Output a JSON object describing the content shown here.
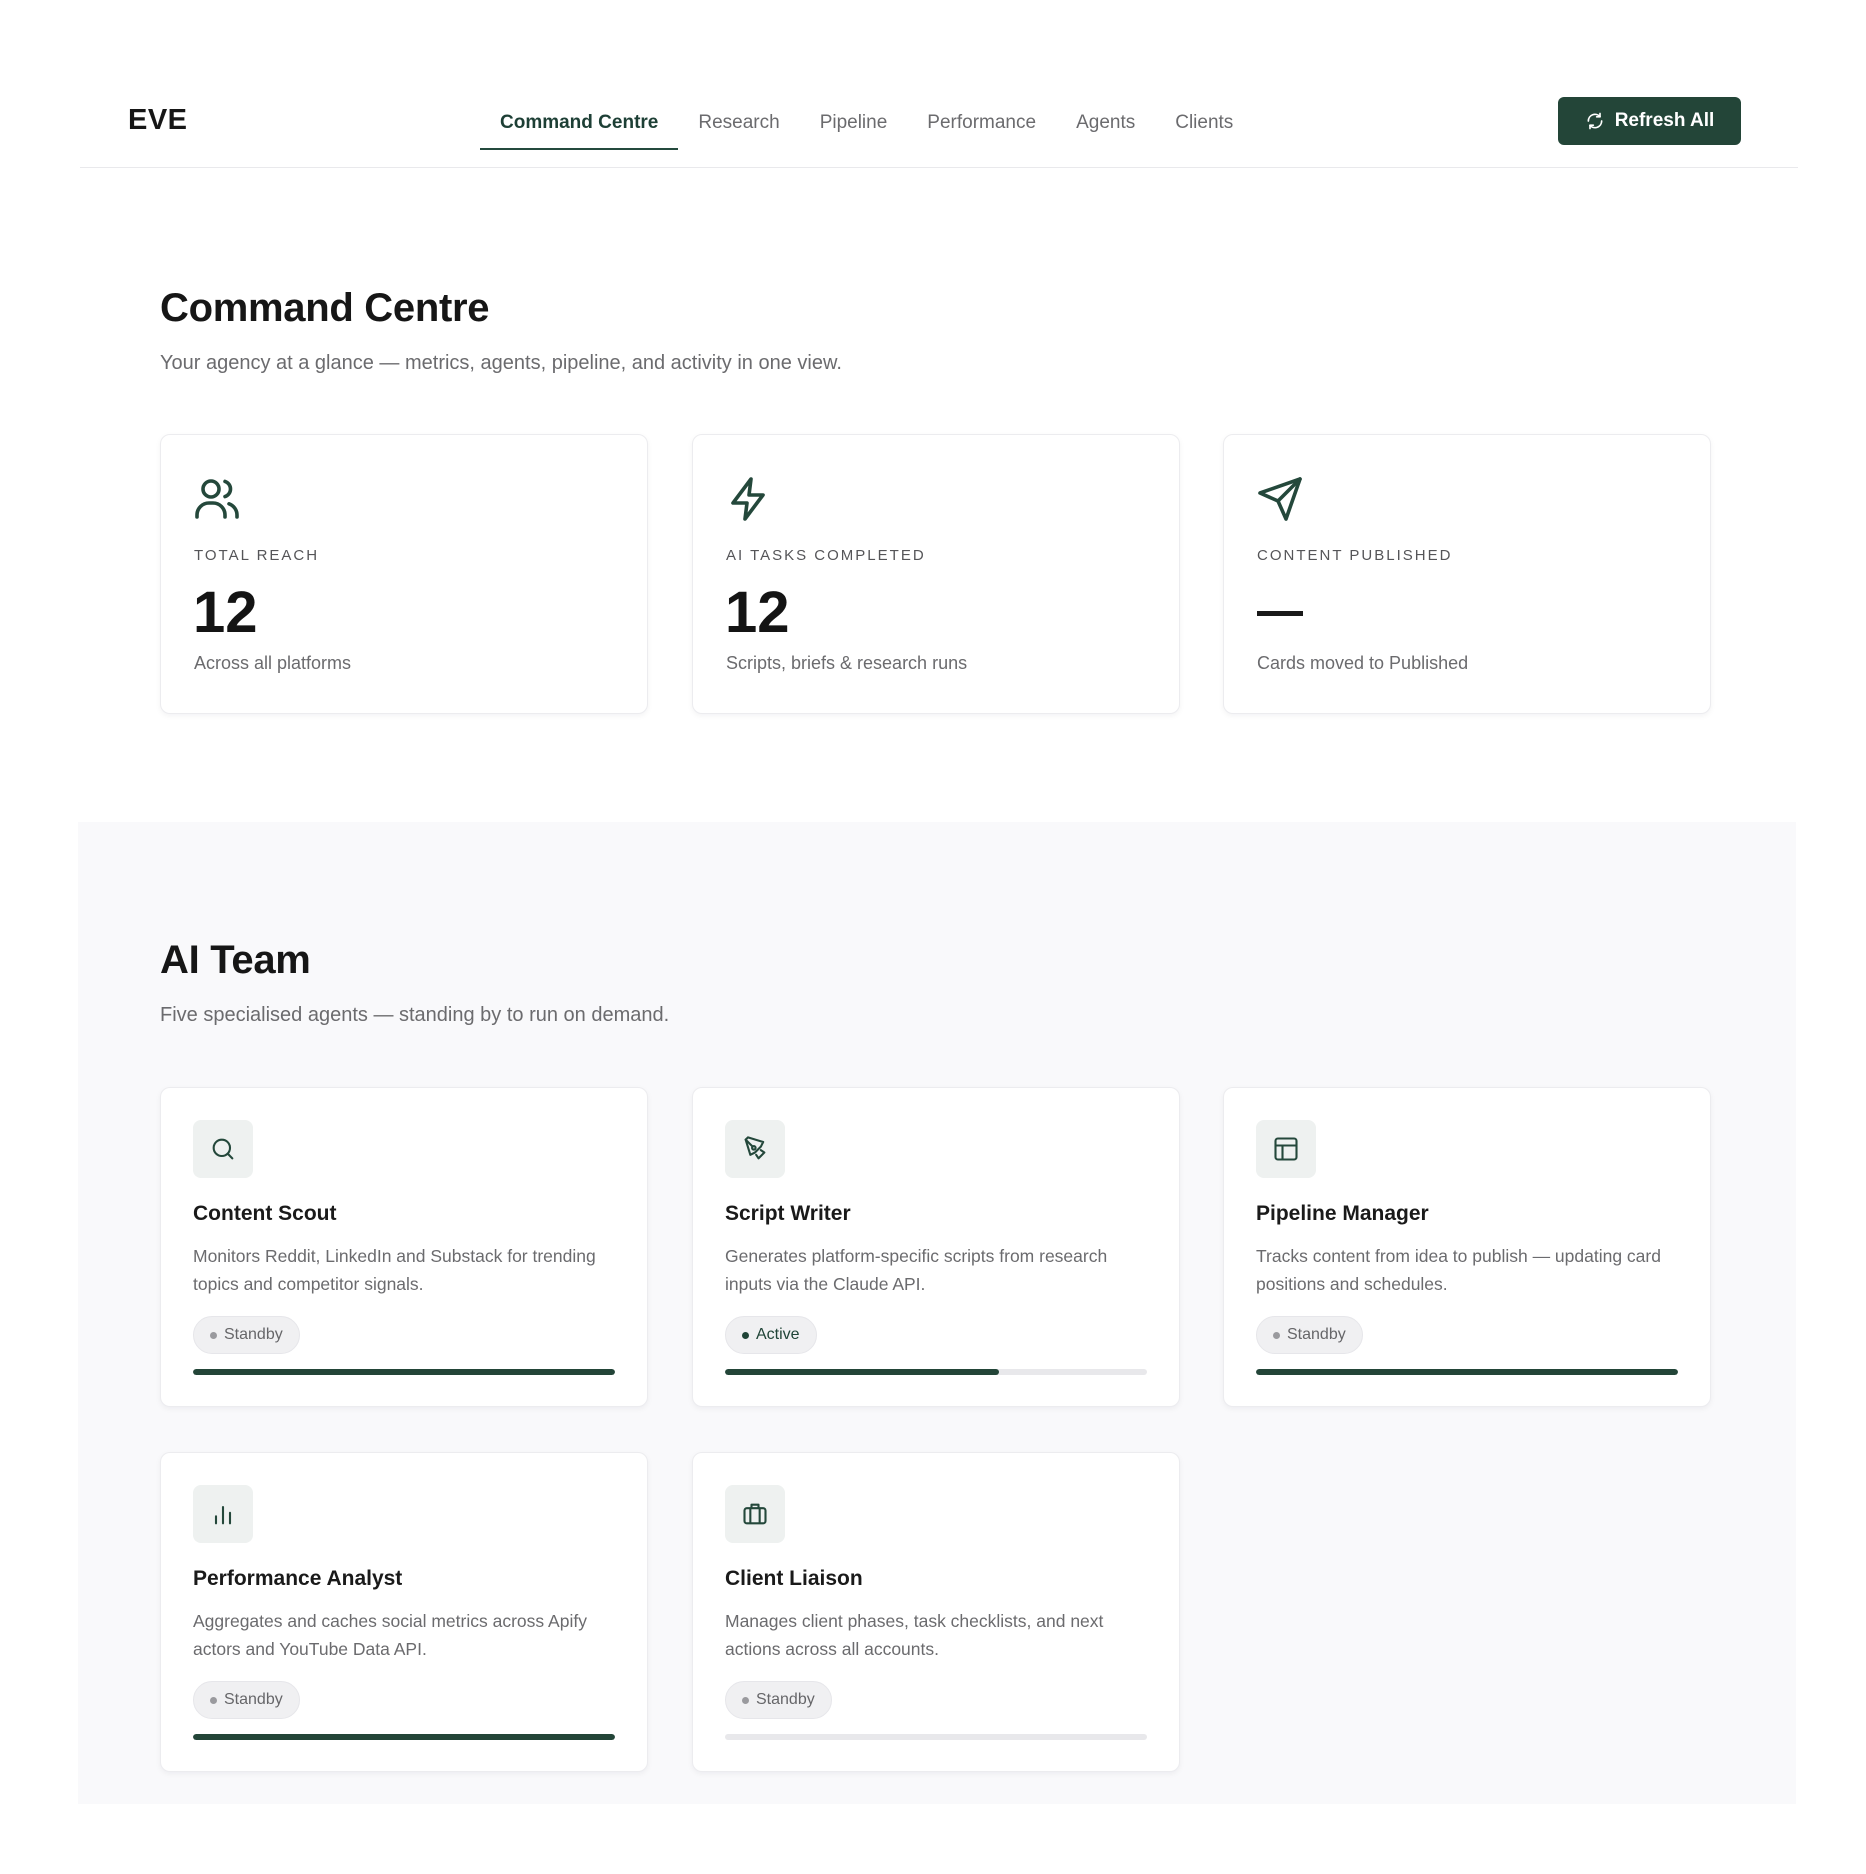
{
  "header": {
    "logo": "EVE",
    "nav": [
      {
        "label": "Command Centre",
        "active": true
      },
      {
        "label": "Research",
        "active": false
      },
      {
        "label": "Pipeline",
        "active": false
      },
      {
        "label": "Performance",
        "active": false
      },
      {
        "label": "Agents",
        "active": false
      },
      {
        "label": "Clients",
        "active": false
      }
    ],
    "refresh_label": "Refresh All"
  },
  "command_centre": {
    "title": "Command Centre",
    "subtitle": "Your agency at a glance — metrics, agents, pipeline, and activity in one view.",
    "stats": [
      {
        "icon": "users-icon",
        "label": "TOTAL REACH",
        "value": "12",
        "desc": "Across all platforms"
      },
      {
        "icon": "lightning-icon",
        "label": "AI TASKS COMPLETED",
        "value": "12",
        "desc": "Scripts, briefs & research runs"
      },
      {
        "icon": "send-icon",
        "label": "CONTENT PUBLISHED",
        "value": "—",
        "desc": "Cards moved to Published"
      }
    ]
  },
  "ai_team": {
    "title": "AI Team",
    "subtitle": "Five specialised agents — standing by to run on demand.",
    "agents": [
      {
        "icon": "search-icon",
        "name": "Content Scout",
        "desc": "Monitors Reddit, LinkedIn and Substack for trending topics and competitor signals.",
        "status": "Standby",
        "progress": 1.0
      },
      {
        "icon": "pen-icon",
        "name": "Script Writer",
        "desc": "Generates platform-specific scripts from research inputs via the Claude API.",
        "status": "Active",
        "progress": 0.65
      },
      {
        "icon": "layout-icon",
        "name": "Pipeline Manager",
        "desc": "Tracks content from idea to publish — updating card positions and schedules.",
        "status": "Standby",
        "progress": 1.0
      },
      {
        "icon": "bar-chart-icon",
        "name": "Performance Analyst",
        "desc": "Aggregates and caches social metrics across Apify actors and YouTube Data API.",
        "status": "Standby",
        "progress": 1.0
      },
      {
        "icon": "briefcase-icon",
        "name": "Client Liaison",
        "desc": "Manages client phases, task checklists, and next actions across all accounts.",
        "status": "Standby",
        "progress": 0.0
      }
    ]
  },
  "colors": {
    "accent": "#234538",
    "text_muted": "#6b6b6e",
    "panel_bg": "#f9f9fb"
  }
}
